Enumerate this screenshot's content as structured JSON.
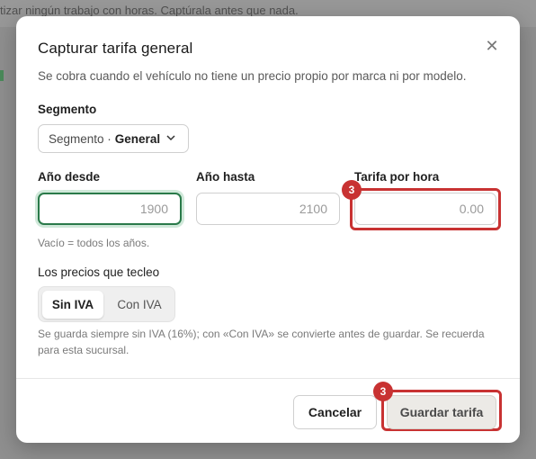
{
  "background": {
    "banner_text": "tizar ningún trabajo con horas. Captúrala antes que nada."
  },
  "dialog": {
    "title": "Capturar tarifa general",
    "subtitle": "Se cobra cuando el vehículo no tiene un precio propio por marca ni por modelo.",
    "close_icon": "close-icon",
    "segment": {
      "label": "Segmento",
      "prefix": "Segmento ·",
      "value": "General",
      "icon": "chevron-down-icon"
    },
    "year_from": {
      "label": "Año desde",
      "placeholder": "1900",
      "value": ""
    },
    "year_to": {
      "label": "Año hasta",
      "placeholder": "2100",
      "value": ""
    },
    "hourly_rate": {
      "label": "Tarifa por hora",
      "placeholder": "0.00",
      "value": "",
      "badge": "3"
    },
    "years_hint": "Vacío = todos los años.",
    "price_mode": {
      "label": "Los precios que tecleo",
      "options": [
        "Sin IVA",
        "Con IVA"
      ],
      "selected": "Sin IVA"
    },
    "price_note": "Se guarda siempre sin IVA (16%); con «Con IVA» se convierte antes de guardar. Se recuerda para esta sucursal.",
    "buttons": {
      "cancel": "Cancelar",
      "save": "Guardar tarifa",
      "save_badge": "3"
    }
  },
  "colors": {
    "focus_green": "#2a7a4a",
    "highlight_red": "#c83232",
    "overlay": "#8f8f8f"
  }
}
